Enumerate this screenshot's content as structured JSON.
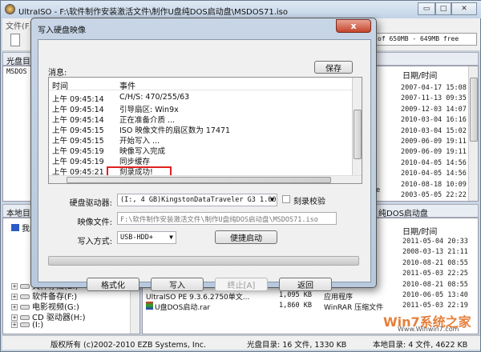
{
  "window": {
    "title": "UltraISO - F:\\软件制作安装激活文件\\制作U盘纯DOS启动盘\\MSDOS71.iso",
    "minimize": "▭",
    "maximize": "□",
    "close": "✕"
  },
  "menu": {
    "file": "文件(F)"
  },
  "toolbar": {
    "size_info": "of 650MB - 649MB free"
  },
  "iso_pane": {
    "header": "光盘目",
    "root": "MSDOS"
  },
  "iso_files": {
    "col_date": "日期/时间",
    "dates": [
      "2007-04-17 15:08",
      "2007-11-13 09:35",
      "2009-12-03 14:07",
      "2010-03-04 16:16",
      "2010-03-04 15:02",
      "2009-06-09 19:11",
      "2009-06-09 19:11",
      "2010-04-05 14:56",
      "2010-04-05 14:56",
      "2010-08-18 10:09",
      "2003-05-05 22:22"
    ],
    "partial_name": "Le"
  },
  "local_pane": {
    "header": "本地目",
    "items": [
      {
        "label": "我的"
      },
      {
        "label": "文件存储(E:)"
      },
      {
        "label": "软件备存(F:)"
      },
      {
        "label": "电影视频(G:)"
      },
      {
        "label": "CD 驱动器(H:)"
      },
      {
        "label": "(I:)"
      }
    ]
  },
  "local_files": {
    "path": "纯DOS启动盘",
    "col_date": "日期/时间",
    "dates": [
      "2011-05-04 20:33",
      "2008-03-13 21:11",
      "2010-08-21 08:55",
      "2011-05-03 22:25",
      "2010-08-21 08:55",
      "2010-06-05 13:40",
      "2011-05-03 22:19"
    ],
    "files": [
      {
        "name": "UltraISO PE 9.3.6.2750单文...",
        "size": "1,095 KB",
        "type": "应用程序"
      },
      {
        "name": "U盘DOS启动.rar",
        "size": "1,860 KB",
        "type": "WinRAR 压缩文件"
      }
    ]
  },
  "statusbar": {
    "copyright": "版权所有 (c)2002-2010 EZB Systems, Inc.",
    "iso_dir": "光盘目录: 16 文件, 1330 KB",
    "local_dir": "本地目录: 4 文件, 4622 KB"
  },
  "watermark": {
    "text": "Win7系统之家",
    "url": "Www.Winwin7.com"
  },
  "dialog": {
    "title": "写入硬盘映像",
    "close": "x",
    "messages_label": "消息:",
    "save": "保存",
    "log": {
      "col_time": "时间",
      "col_event": "事件",
      "rows": [
        {
          "time": "上午 09:45:14",
          "event": "C/H/S: 470/255/63"
        },
        {
          "time": "上午 09:45:14",
          "event": "引导扇区: Win9x"
        },
        {
          "time": "上午 09:45:14",
          "event": "正在准备介质 ..."
        },
        {
          "time": "上午 09:45:15",
          "event": "ISO 映像文件的扇区数为 17471"
        },
        {
          "time": "上午 09:45:15",
          "event": "开始写入 ..."
        },
        {
          "time": "上午 09:45:19",
          "event": "映像写入完成"
        },
        {
          "time": "上午 09:45:19",
          "event": "同步缓存"
        },
        {
          "time": "上午 09:45:21",
          "event": "刻录成功!"
        }
      ]
    },
    "drive_label": "硬盘驱动器:",
    "drive_value": "(I:, 4 GB)KingstonDataTraveler G3 1.00",
    "verify_label": "刻录校验",
    "image_label": "映像文件:",
    "image_value": "F:\\软件制作安装激活文件\\制作U盘纯DOS启动盘\\MSDOS71.iso",
    "method_label": "写入方式:",
    "method_value": "USB-HDD+",
    "quick_boot": "便捷启动",
    "progress": 0,
    "buttons": {
      "format": "格式化",
      "write": "写入",
      "abort": "终止[A]",
      "back": "返回"
    },
    "highlight_color": "#e02020"
  }
}
